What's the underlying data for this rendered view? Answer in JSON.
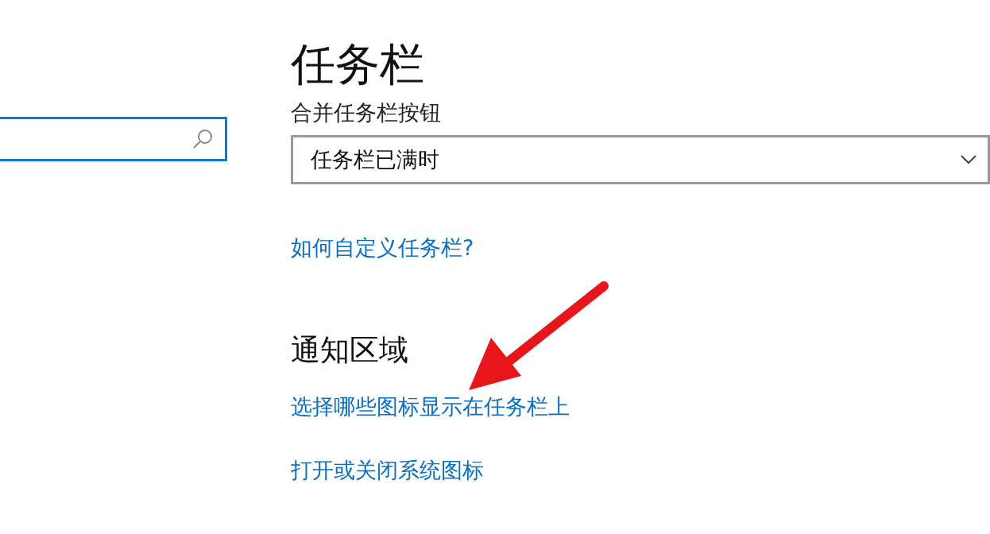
{
  "search": {
    "focused": true
  },
  "page_title": "任务栏",
  "combine_buttons": {
    "label": "合并任务栏按钮",
    "value": "任务栏已满时"
  },
  "help_link": "如何自定义任务栏?",
  "notification_area": {
    "heading": "通知区域",
    "links": [
      "选择哪些图标显示在任务栏上",
      "打开或关闭系统图标"
    ]
  },
  "annotation": {
    "kind": "arrow"
  }
}
